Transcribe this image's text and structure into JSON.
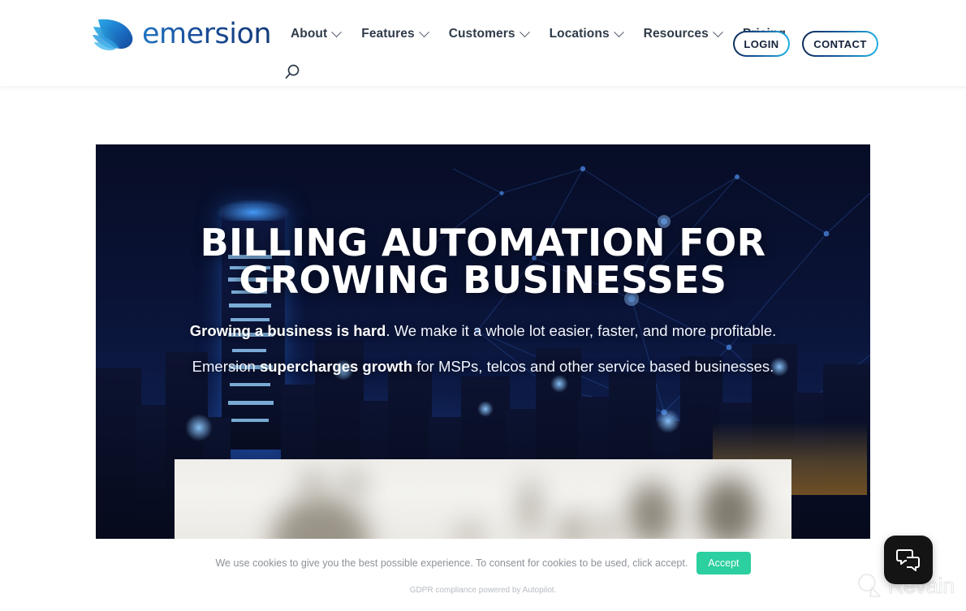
{
  "header": {
    "logo_word": "emersion",
    "logo_icon": "emersion-leaf-logo",
    "search_icon": "search-icon",
    "nav": [
      {
        "label": "About",
        "has_dropdown": true
      },
      {
        "label": "Features",
        "has_dropdown": true
      },
      {
        "label": "Customers",
        "has_dropdown": true
      },
      {
        "label": "Locations",
        "has_dropdown": true
      },
      {
        "label": "Resources",
        "has_dropdown": true
      },
      {
        "label": "Pricing",
        "has_dropdown": false
      }
    ],
    "login_label": "LOGIN",
    "contact_label": "CONTACT"
  },
  "hero": {
    "heading_line1": "BILLING AUTOMATION FOR",
    "heading_line2": "GROWING BUSINESSES",
    "sub1_bold": "Growing a business is hard",
    "sub1_rest": ". We make it a whole lot easier, faster, and more profitable.",
    "sub2_pre": "Emersion ",
    "sub2_bold": "supercharges growth",
    "sub2_rest": " for MSPs, telcos and other service based businesses."
  },
  "cookie": {
    "message": "We use cookies to give you the best possible experience. To consent for cookies to be used, click accept.",
    "accept_label": "Accept",
    "gdpr_note": "GDPR compliance powered by Autopilot.",
    "accept_color": "#2bcfa0"
  },
  "chat": {
    "icon": "chat-bubbles-icon",
    "background": "#141414"
  },
  "watermark": {
    "label": "Revain",
    "icon": "revain-logo-icon"
  },
  "colors": {
    "nav_text": "#2f3b49",
    "hero_dark": "#080f2c",
    "brand_blue": "#1e73be",
    "brand_cyan": "#22b6e6"
  }
}
